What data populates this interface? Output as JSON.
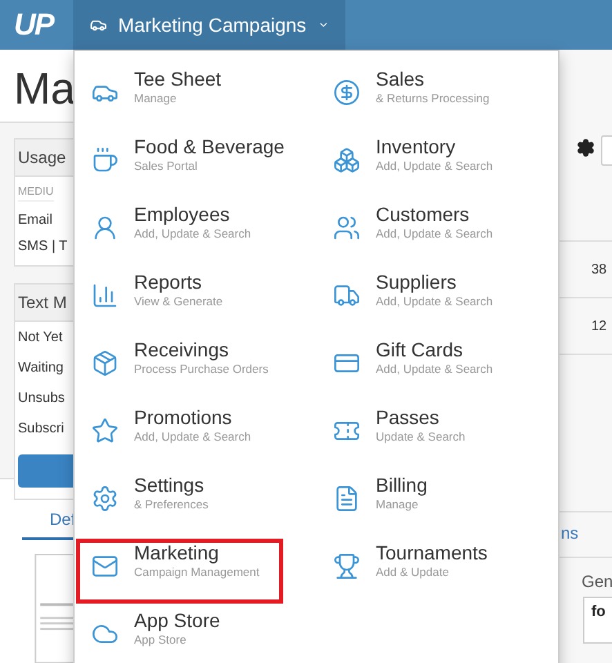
{
  "header": {
    "logo": "UP",
    "nav_title": "Marketing Campaigns"
  },
  "page": {
    "title": "Ma",
    "usage_panel": {
      "title": "Usage",
      "column": "MEDIU",
      "rows": [
        "Email",
        "SMS | T"
      ]
    },
    "text_panel": {
      "title": "Text M",
      "rows": [
        "Not Yet",
        "Waiting",
        "Unsubs",
        "Subscri"
      ]
    },
    "tab": {
      "label": "Def",
      "selected": true
    },
    "right": {
      "values": [
        "38",
        "12"
      ],
      "tab": "ns",
      "column": "Gen",
      "card_title": "fo"
    }
  },
  "menu": {
    "columns": [
      [
        {
          "title": "Tee Sheet",
          "subtitle": "Manage",
          "highlighted": false
        },
        {
          "title": "Food & Beverage",
          "subtitle": "Sales Portal",
          "highlighted": false
        },
        {
          "title": "Employees",
          "subtitle": "Add, Update & Search",
          "highlighted": false
        },
        {
          "title": "Reports",
          "subtitle": "View & Generate",
          "highlighted": false
        },
        {
          "title": "Receivings",
          "subtitle": "Process Purchase Orders",
          "highlighted": false
        },
        {
          "title": "Promotions",
          "subtitle": "Add, Update & Search",
          "highlighted": false
        },
        {
          "title": "Settings",
          "subtitle": "& Preferences",
          "highlighted": false
        },
        {
          "title": "Marketing",
          "subtitle": "Campaign Management",
          "highlighted": true
        },
        {
          "title": "App Store",
          "subtitle": "App Store",
          "highlighted": false
        }
      ],
      [
        {
          "title": "Sales",
          "subtitle": "& Returns Processing",
          "highlighted": false
        },
        {
          "title": "Inventory",
          "subtitle": "Add, Update & Search",
          "highlighted": false
        },
        {
          "title": "Customers",
          "subtitle": "Add, Update & Search",
          "highlighted": false
        },
        {
          "title": "Suppliers",
          "subtitle": "Add, Update & Search",
          "highlighted": false
        },
        {
          "title": "Gift Cards",
          "subtitle": "Add, Update & Search",
          "highlighted": false
        },
        {
          "title": "Passes",
          "subtitle": "Update & Search",
          "highlighted": false
        },
        {
          "title": "Billing",
          "subtitle": "Manage",
          "highlighted": false
        },
        {
          "title": "Tournaments",
          "subtitle": "Add & Update",
          "highlighted": false
        }
      ]
    ]
  }
}
